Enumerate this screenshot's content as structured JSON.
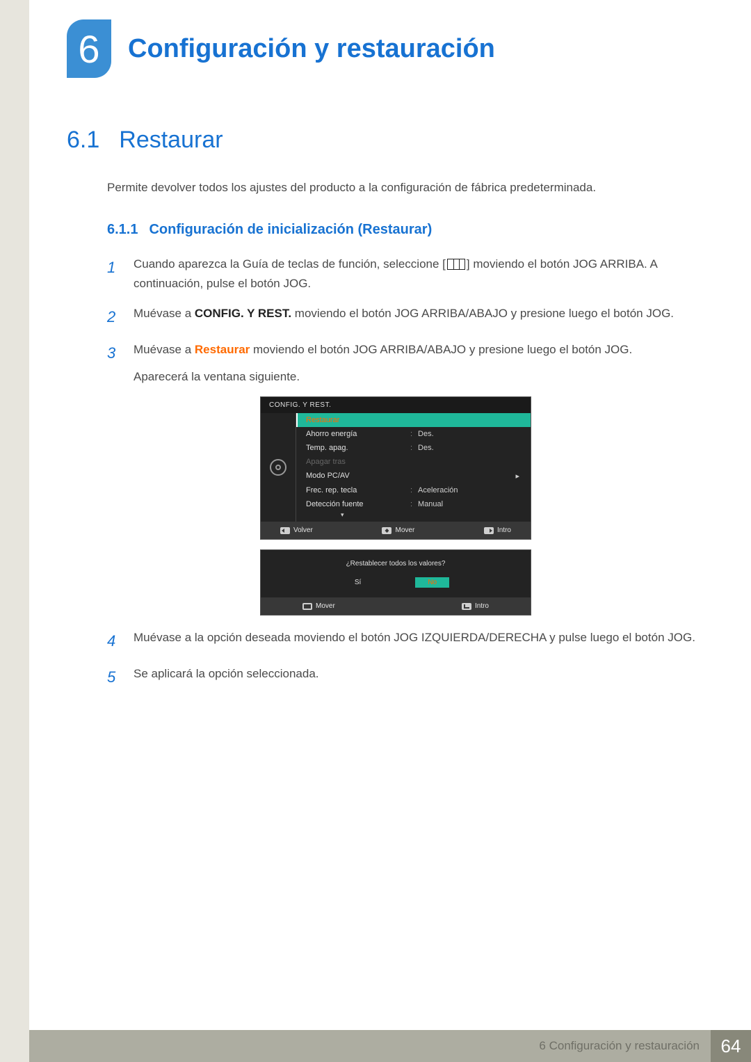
{
  "chapter": {
    "number": "6",
    "title": "Configuración y restauración"
  },
  "section": {
    "number": "6.1",
    "title": "Restaurar",
    "intro": "Permite devolver todos los ajustes del producto a la configuración de fábrica predeterminada."
  },
  "subsection": {
    "number": "6.1.1",
    "title": "Configuración de inicialización (Restaurar)"
  },
  "steps": {
    "s1": {
      "num": "1",
      "pre": "Cuando aparezca la Guía de teclas de función, seleccione [",
      "post": "] moviendo el botón JOG ARRIBA. A continuación, pulse el botón JOG."
    },
    "s2": {
      "num": "2",
      "pre": "Muévase a ",
      "bold": "CONFIG. Y REST.",
      "post": " moviendo el botón JOG ARRIBA/ABAJO y presione luego el botón JOG."
    },
    "s3": {
      "num": "3",
      "pre": "Muévase a ",
      "bold": "Restaurar",
      "post": " moviendo el botón JOG ARRIBA/ABAJO y presione luego el botón JOG.",
      "after": "Aparecerá la ventana siguiente."
    },
    "s4": {
      "num": "4",
      "text": "Muévase a la opción deseada moviendo el botón JOG IZQUIERDA/DERECHA y pulse luego el botón JOG."
    },
    "s5": {
      "num": "5",
      "text": "Se aplicará la opción seleccionada."
    }
  },
  "osd": {
    "title": "CONFIG. Y REST.",
    "items": [
      {
        "label": "Restaurar",
        "value": "",
        "selected": true
      },
      {
        "label": "Ahorro energía",
        "value": "Des."
      },
      {
        "label": "Temp. apag.",
        "value": "Des."
      },
      {
        "label": "Apagar tras",
        "value": "",
        "disabled": true
      },
      {
        "label": "Modo PC/AV",
        "value": "",
        "arrow": true
      },
      {
        "label": "Frec. rep. tecla",
        "value": "Aceleración"
      },
      {
        "label": "Detección fuente",
        "value": "Manual"
      }
    ],
    "footer": {
      "back": "Volver",
      "move": "Mover",
      "enter": "Intro"
    }
  },
  "dialog": {
    "question": "¿Restablecer todos los valores?",
    "yes": "Sí",
    "no": "No",
    "footer": {
      "move": "Mover",
      "enter": "Intro"
    }
  },
  "footer": {
    "label": "6 Configuración y restauración",
    "page": "64"
  }
}
